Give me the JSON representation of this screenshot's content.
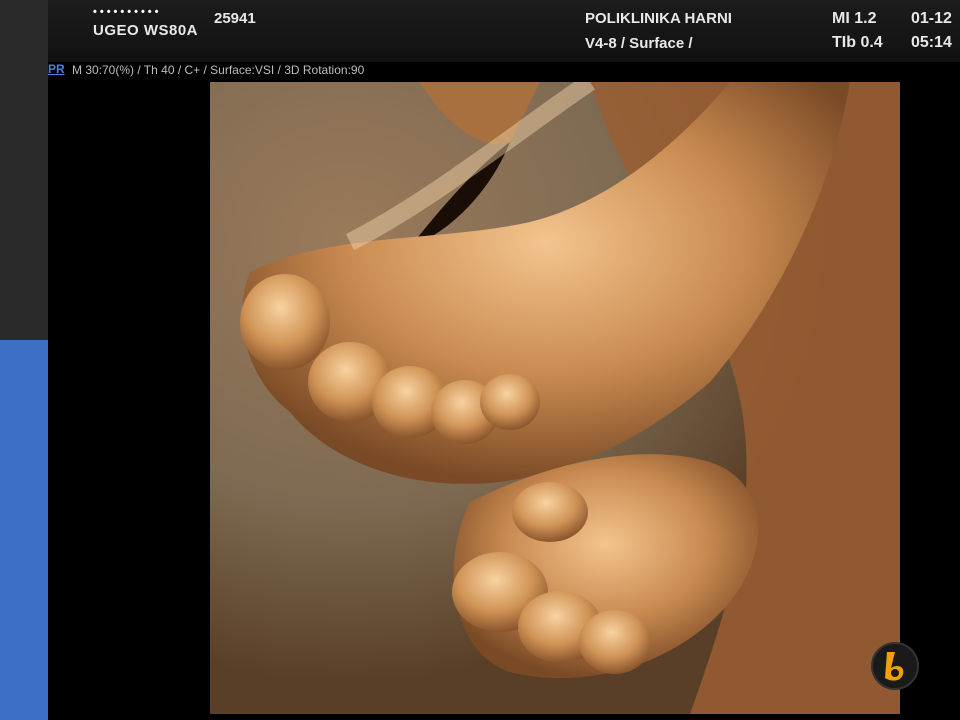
{
  "header": {
    "dots": "••••••••••",
    "model": "UGEO WS80A",
    "study_id": "25941",
    "clinic": "POLIKLINIKA HARNI",
    "probe_mode": "V4-8 / Surface /",
    "mi": "MI  1.2",
    "tib": "TIb 0.4",
    "date": "01-12",
    "time": "05:14"
  },
  "status": {
    "mode_tag": "PR",
    "params": "M 30:70(%) / Th 40 / C+ / Surface:VSI / 3D Rotation:90"
  },
  "colors": {
    "sidebar_blue": "#3e6fc6",
    "mode_tag_blue": "#4e7fe0",
    "render_tint": "#b97844"
  }
}
